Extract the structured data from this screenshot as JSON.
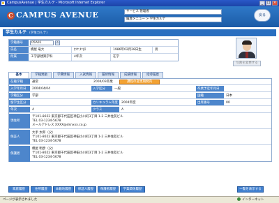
{
  "window": {
    "title": "CampusAvenue | 学生カルテ - Microsoft Internet Explorer"
  },
  "header": {
    "logo_text": "CAMPUS AVENUE",
    "service_name": "サービス 管理者",
    "menu_path": "履歴メニュー > 学生カルテ",
    "back_label": "戻る"
  },
  "page": {
    "title": "学生カルテ",
    "subtitle": "(学生カルテ)"
  },
  "profile": {
    "student_no_label": "学籍番号",
    "student_no_value": "05A01",
    "search_icon": "magnifier-icon",
    "name_label": "氏名",
    "name_value": "橋屋 竜大",
    "reading_value": "ｶﾂﾔ ﾀﾂﾋﾛ",
    "birth_value": "1986年02月28日生",
    "gender_value": "男",
    "dept_label": "所属",
    "dept_value": "工学部建築学科",
    "grade_value": "4年次",
    "status_value": "在学"
  },
  "photo_button": "写真を変更する",
  "tabs": [
    "基本",
    "学籍異動",
    "学費情報",
    "入試情報",
    "履修情報",
    "成績情報",
    "指導履歴"
  ],
  "detail": {
    "enroll_course_label": "在籍学籍",
    "enroll_course_value": "通常",
    "enroll_year_value": "2004/03卒業",
    "orange_label": "課程の変更期間内",
    "entrance_date_label": "入学年月日",
    "entrance_date_value": "2004/04/04",
    "entrance_type_label": "入学区分",
    "entrance_type_value": "一般",
    "grad_year_label": "卒業予定年月日",
    "school_label": "学籍区分",
    "school_value": "学部",
    "nationality_label": "国籍",
    "nationality_value": "日本",
    "study_label": "留学生区分",
    "curriculum_label": "カリキュラム年度",
    "curriculum_value": "2004年度",
    "id_label": "出席番号",
    "id_value": "00",
    "grade_label": "年次",
    "grade_value": "4",
    "class_label": "クラス",
    "class_value": "A",
    "current_addr_label": "現住所",
    "current_addr_value": "〒101-8652 東京都千代田区神田小川町3丁目 1-2 三井住友ビル\nTEL 03-1234-5678\nメールアドレス XXXX@dsnxxx.co.jp",
    "guardian_label": "保証人",
    "guardian_value": "大手 太郎（父）\n〒101-8652 東京都千代田区神田小川町3丁目 1-2 三井住友ビル\nTEL 03-1234-5678",
    "parent_label": "保護者",
    "parent_value": "橋屋 明彦（父）\n〒101-8652 東京都千代田区神田小川町3丁目 1-2 三井住友ビル\nTEL 03-1234-5678"
  },
  "bottom_buttons": [
    "家庭履歴",
    "住所履歴",
    "本籍地履歴",
    "保証人履歴",
    "保護者履歴",
    "学業関係履歴"
  ],
  "print_button": "一覧を表示する",
  "status": {
    "left": "ページが表示されました",
    "right": "インターネット"
  }
}
